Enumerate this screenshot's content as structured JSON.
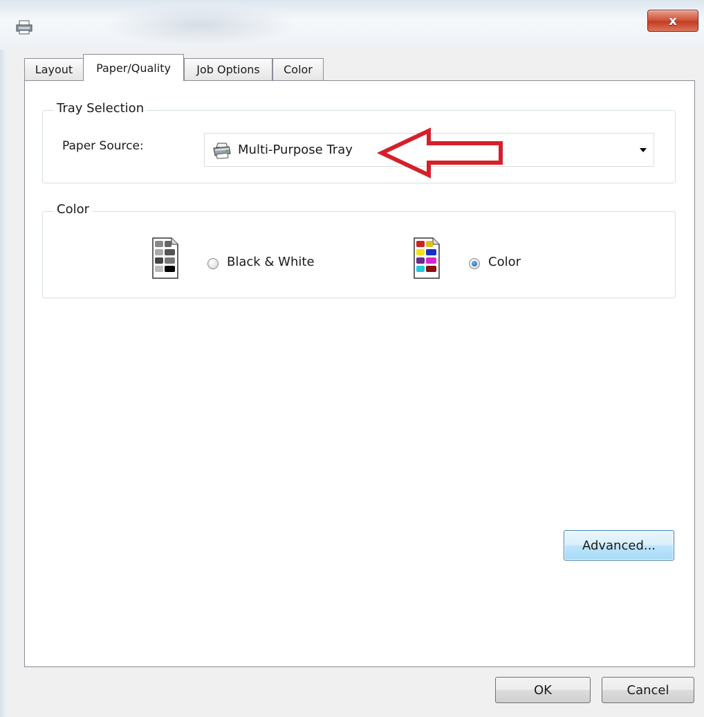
{
  "window": {
    "title": "",
    "close_symbol": "x"
  },
  "tabs": [
    {
      "label": "Layout",
      "active": false
    },
    {
      "label": "Paper/Quality",
      "active": true
    },
    {
      "label": "Job Options",
      "active": false
    },
    {
      "label": "Color",
      "active": false
    }
  ],
  "tray_selection": {
    "legend": "Tray Selection",
    "paper_source_label": "Paper Source:",
    "paper_source_value": "Multi-Purpose Tray",
    "paper_source_icon": "printer-icon"
  },
  "color_group": {
    "legend": "Color",
    "options": [
      {
        "label": "Black & White",
        "checked": false,
        "icon": "black-white-document-icon"
      },
      {
        "label": "Color",
        "checked": true,
        "icon": "color-document-icon"
      }
    ]
  },
  "buttons": {
    "advanced": "Advanced...",
    "ok": "OK",
    "cancel": "Cancel"
  },
  "colors": {
    "annotation_arrow": "#d4202a",
    "close_button": "#c9452e",
    "page_background": "#ffffff"
  }
}
